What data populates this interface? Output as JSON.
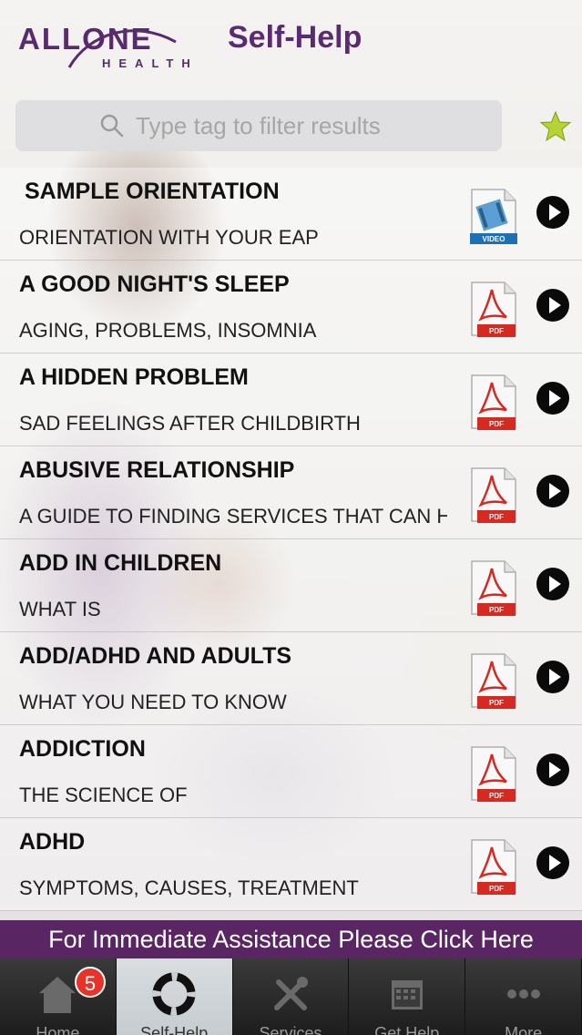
{
  "header": {
    "logo_text": "ALLONE",
    "logo_subtext": "HEALTH",
    "title": "Self-Help"
  },
  "search": {
    "placeholder": "Type tag to filter results"
  },
  "items": [
    {
      "title": "SAMPLE ORIENTATION",
      "subtitle": "ORIENTATION WITH YOUR EAP",
      "file_type": "VIDEO"
    },
    {
      "title": "A GOOD NIGHT'S SLEEP",
      "subtitle": "AGING, PROBLEMS, INSOMNIA",
      "file_type": "PDF"
    },
    {
      "title": "A HIDDEN PROBLEM",
      "subtitle": "SAD FEELINGS AFTER CHILDBIRTH",
      "file_type": "PDF"
    },
    {
      "title": "ABUSIVE RELATIONSHIP",
      "subtitle": "A GUIDE TO FINDING SERVICES THAT CAN H",
      "file_type": "PDF"
    },
    {
      "title": "ADD IN CHILDREN",
      "subtitle": "WHAT IS",
      "file_type": "PDF"
    },
    {
      "title": "ADD/ADHD AND ADULTS",
      "subtitle": "WHAT YOU NEED TO KNOW",
      "file_type": "PDF"
    },
    {
      "title": "ADDICTION",
      "subtitle": "THE SCIENCE OF",
      "file_type": "PDF"
    },
    {
      "title": "ADHD",
      "subtitle": "SYMPTOMS, CAUSES, TREATMENT",
      "file_type": "PDF"
    }
  ],
  "banner": {
    "text": "For Immediate Assistance Please Click Here"
  },
  "tabs": [
    {
      "label": "Home",
      "icon": "home-icon",
      "badge": "5"
    },
    {
      "label": "Self-Help",
      "icon": "lifebuoy-icon",
      "active": true
    },
    {
      "label": "Services",
      "icon": "tools-icon"
    },
    {
      "label": "Get Help",
      "icon": "calendar-icon"
    },
    {
      "label": "More",
      "icon": "more-icon"
    }
  ],
  "colors": {
    "brand_purple": "#5a2563",
    "brand_orange": "#e08a2a",
    "star_green": "#b5d334",
    "badge_red": "#e8322a"
  }
}
